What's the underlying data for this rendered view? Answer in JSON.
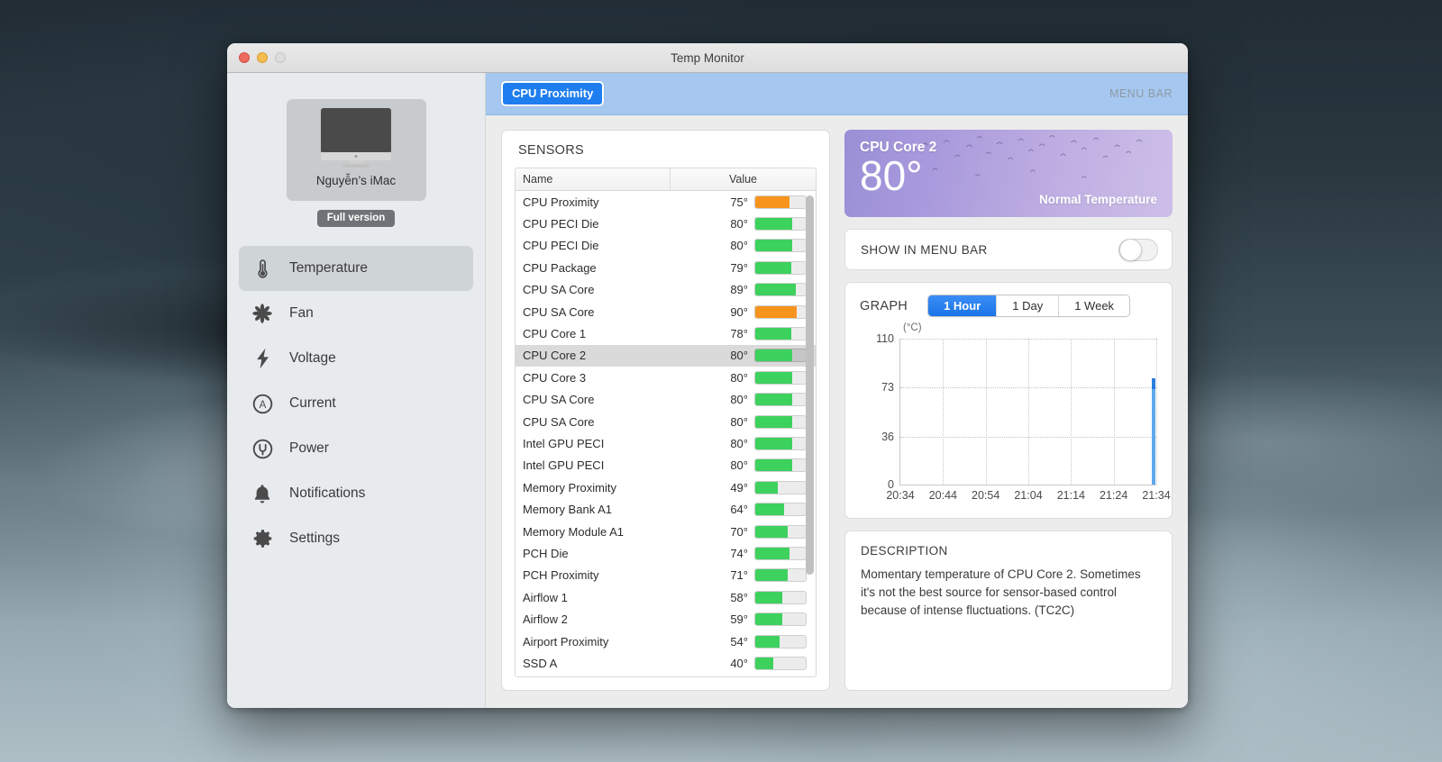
{
  "window": {
    "title": "Temp Monitor",
    "traffic_lights": [
      "close-red",
      "minimize-yellow",
      "zoom-disabled"
    ]
  },
  "sidebar": {
    "device_name": "Nguyễn’s iMac",
    "badge": "Full version",
    "items": [
      {
        "label": "Temperature",
        "icon": "thermometer-icon",
        "active": true
      },
      {
        "label": "Fan",
        "icon": "fan-icon",
        "active": false
      },
      {
        "label": "Voltage",
        "icon": "bolt-icon",
        "active": false
      },
      {
        "label": "Current",
        "icon": "ampere-circle-icon",
        "active": false
      },
      {
        "label": "Power",
        "icon": "power-plug-icon",
        "active": false
      },
      {
        "label": "Notifications",
        "icon": "bell-icon",
        "active": false
      },
      {
        "label": "Settings",
        "icon": "gear-icon",
        "active": false
      }
    ]
  },
  "toolbar": {
    "selected_sensor": "CPU Proximity",
    "menu_bar_label": "MENU BAR"
  },
  "sensors_panel": {
    "title": "SENSORS",
    "columns": [
      "Name",
      "Value"
    ],
    "rows": [
      {
        "name": "CPU Proximity",
        "value": "75°",
        "pct": 68,
        "color": "#f7941e",
        "selected": false
      },
      {
        "name": "CPU PECI Die",
        "value": "80°",
        "pct": 73,
        "color": "#3dd15e",
        "selected": false
      },
      {
        "name": "CPU PECI Die",
        "value": "80°",
        "pct": 73,
        "color": "#3dd15e",
        "selected": false
      },
      {
        "name": "CPU Package",
        "value": "79°",
        "pct": 72,
        "color": "#3dd15e",
        "selected": false
      },
      {
        "name": "CPU SA Core",
        "value": "89°",
        "pct": 81,
        "color": "#3dd15e",
        "selected": false
      },
      {
        "name": "CPU SA Core",
        "value": "90°",
        "pct": 82,
        "color": "#f7941e",
        "selected": false
      },
      {
        "name": "CPU Core 1",
        "value": "78°",
        "pct": 71,
        "color": "#3dd15e",
        "selected": false
      },
      {
        "name": "CPU Core 2",
        "value": "80°",
        "pct": 73,
        "color": "#3dd15e",
        "selected": true
      },
      {
        "name": "CPU Core 3",
        "value": "80°",
        "pct": 73,
        "color": "#3dd15e",
        "selected": false
      },
      {
        "name": "CPU SA Core",
        "value": "80°",
        "pct": 73,
        "color": "#3dd15e",
        "selected": false
      },
      {
        "name": "CPU SA Core",
        "value": "80°",
        "pct": 73,
        "color": "#3dd15e",
        "selected": false
      },
      {
        "name": "Intel GPU PECI",
        "value": "80°",
        "pct": 73,
        "color": "#3dd15e",
        "selected": false
      },
      {
        "name": "Intel GPU PECI",
        "value": "80°",
        "pct": 73,
        "color": "#3dd15e",
        "selected": false
      },
      {
        "name": "Memory Proximity",
        "value": "49°",
        "pct": 45,
        "color": "#3dd15e",
        "selected": false
      },
      {
        "name": "Memory Bank A1",
        "value": "64°",
        "pct": 58,
        "color": "#3dd15e",
        "selected": false
      },
      {
        "name": "Memory Module A1",
        "value": "70°",
        "pct": 64,
        "color": "#3dd15e",
        "selected": false
      },
      {
        "name": "PCH Die",
        "value": "74°",
        "pct": 67,
        "color": "#3dd15e",
        "selected": false
      },
      {
        "name": "PCH Proximity",
        "value": "71°",
        "pct": 65,
        "color": "#3dd15e",
        "selected": false
      },
      {
        "name": "Airflow 1",
        "value": "58°",
        "pct": 53,
        "color": "#3dd15e",
        "selected": false
      },
      {
        "name": "Airflow 2",
        "value": "59°",
        "pct": 54,
        "color": "#3dd15e",
        "selected": false
      },
      {
        "name": "Airport Proximity",
        "value": "54°",
        "pct": 49,
        "color": "#3dd15e",
        "selected": false
      },
      {
        "name": "SSD A",
        "value": "40°",
        "pct": 36,
        "color": "#3dd15e",
        "selected": false
      }
    ]
  },
  "temp_card": {
    "sensor": "CPU Core 2",
    "temperature": "80°",
    "status": "Normal Temperature"
  },
  "menu_bar_card": {
    "label": "SHOW IN MENU BAR",
    "toggle_state": "off"
  },
  "graph": {
    "title": "GRAPH",
    "ranges": [
      {
        "label": "1 Hour",
        "active": true
      },
      {
        "label": "1 Day",
        "active": false
      },
      {
        "label": "1 Week",
        "active": false
      }
    ]
  },
  "chart_data": {
    "type": "line",
    "title": "GRAPH",
    "ylabel": "(°C)",
    "xlabel": "",
    "ylim": [
      0,
      110
    ],
    "yticks": [
      0,
      36,
      73,
      110
    ],
    "x": [
      "20:34",
      "20:44",
      "20:54",
      "21:04",
      "21:14",
      "21:24",
      "21:34"
    ],
    "grid": true,
    "legend": "none",
    "series": [
      {
        "name": "CPU Core 2",
        "color": "#5fa8ec",
        "note": "Only the most recent samples are recorded; trace appears as a vertical band at the right edge reaching ~80°C.",
        "values": [
          null,
          null,
          null,
          null,
          null,
          null,
          80
        ]
      }
    ]
  },
  "description": {
    "title": "DESCRIPTION",
    "text": "Momentary temperature of CPU Core 2. Sometimes it's not the best source for sensor-based control because of intense fluctuations. (TC2C)"
  }
}
